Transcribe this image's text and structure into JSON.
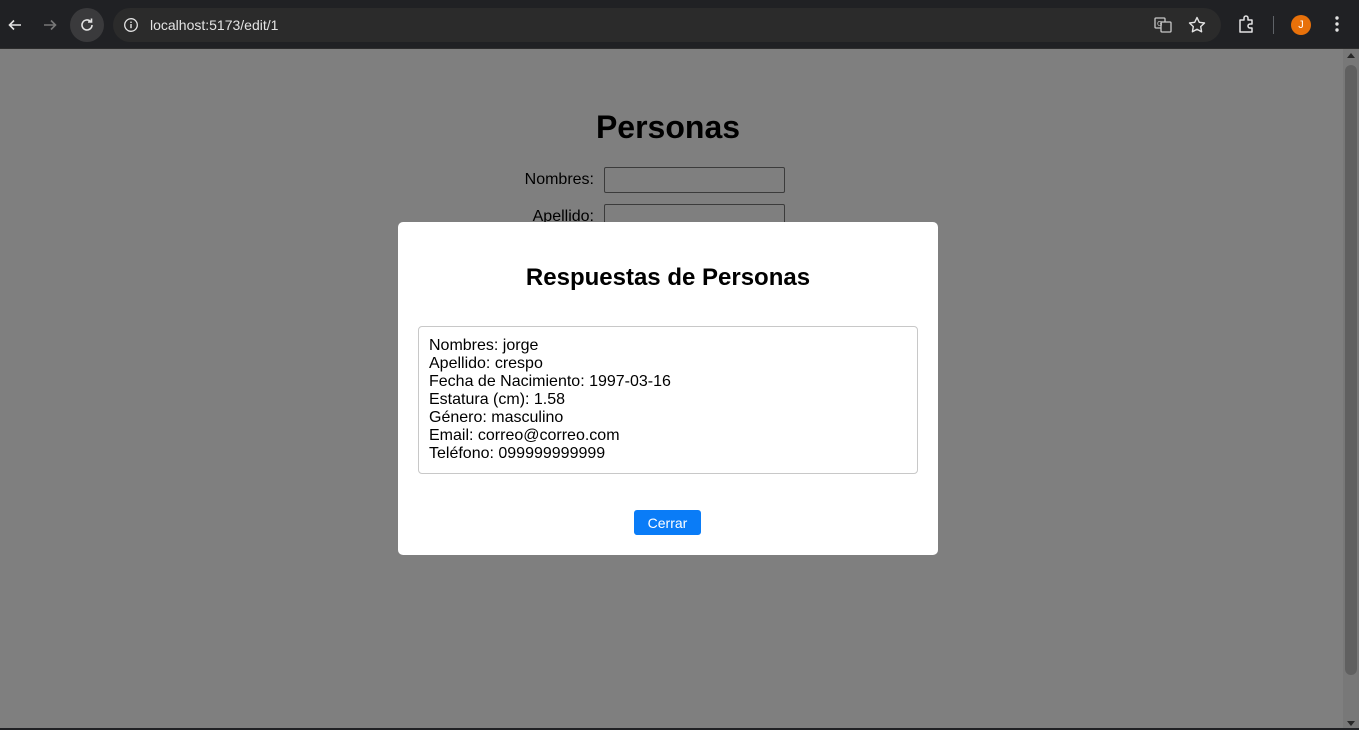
{
  "browser": {
    "url": "localhost:5173/edit/1",
    "profile_initial": "J",
    "icons": [
      "back-arrow-icon",
      "forward-arrow-icon",
      "reload-icon",
      "site-info-icon",
      "translate-icon",
      "bookmark-star-icon",
      "extensions-icon",
      "profile-avatar",
      "more-menu-icon"
    ],
    "colors": {
      "toolbar": "#202124",
      "omnibox": "#2b2b2b",
      "avatar": "#e8710a"
    }
  },
  "page": {
    "title": "Personas",
    "fields": [
      {
        "label": "Nombres:",
        "value": ""
      },
      {
        "label": "Apellido:",
        "value": ""
      }
    ]
  },
  "modal": {
    "title": "Respuestas de Personas",
    "lines": [
      "Nombres: jorge",
      "Apellido: crespo",
      "Fecha de Nacimiento: 1997-03-16",
      "Estatura (cm): 1.58",
      "Género: masculino",
      "Email: correo@correo.com",
      "Teléfono: 099999999999"
    ],
    "close_label": "Cerrar",
    "colors": {
      "button": "#0a7cf7"
    }
  }
}
